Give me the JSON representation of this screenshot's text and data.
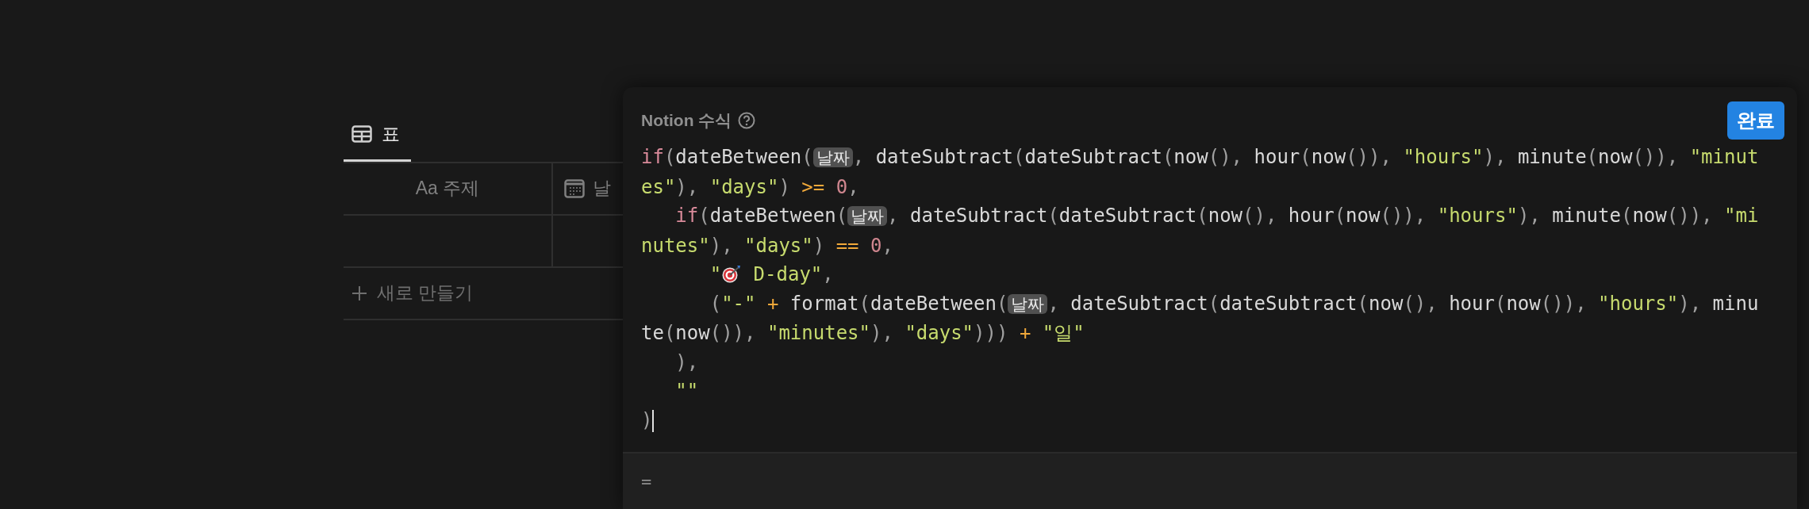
{
  "view_tabs": [
    {
      "label": "표",
      "selected": true
    }
  ],
  "table": {
    "columns": [
      {
        "label": "Aa 주제",
        "kind": "title"
      },
      {
        "label": "날",
        "kind": "date"
      }
    ],
    "new_row_label": "새로 만들기"
  },
  "formula_editor": {
    "title": "Notion 수식",
    "done_button": "완료",
    "lines": [
      {
        "segments": [
          {
            "kind": "code",
            "tokens": [
              {
                "kind": "keyword",
                "text": "if"
              },
              {
                "kind": "punct",
                "text": "("
              },
              {
                "kind": "ident",
                "text": "dateBetween"
              },
              {
                "kind": "punct",
                "text": "("
              }
            ]
          },
          {
            "kind": "prop",
            "text": "날짜"
          },
          {
            "kind": "code",
            "tokens": [
              {
                "kind": "punct",
                "text": ", "
              },
              {
                "kind": "ident",
                "text": "dateSubtract"
              },
              {
                "kind": "punct",
                "text": "("
              },
              {
                "kind": "ident",
                "text": "dateSubtract"
              },
              {
                "kind": "punct",
                "text": "("
              },
              {
                "kind": "ident",
                "text": "now"
              },
              {
                "kind": "punct",
                "text": "(), "
              },
              {
                "kind": "ident",
                "text": "hour"
              },
              {
                "kind": "punct",
                "text": "("
              },
              {
                "kind": "ident",
                "text": "now"
              },
              {
                "kind": "punct",
                "text": "()), "
              },
              {
                "kind": "string",
                "text": "\"hours\""
              },
              {
                "kind": "punct",
                "text": "), "
              },
              {
                "kind": "ident",
                "text": "minute"
              },
              {
                "kind": "punct",
                "text": "("
              },
              {
                "kind": "ident",
                "text": "now"
              },
              {
                "kind": "punct",
                "text": "()), "
              },
              {
                "kind": "string",
                "text": "\"minut"
              }
            ]
          }
        ]
      },
      {
        "segments": [
          {
            "kind": "code",
            "tokens": [
              {
                "kind": "string",
                "text": "es\""
              },
              {
                "kind": "punct",
                "text": "), "
              },
              {
                "kind": "string",
                "text": "\"days\""
              },
              {
                "kind": "punct",
                "text": ") "
              },
              {
                "kind": "op",
                "text": ">= "
              },
              {
                "kind": "number",
                "text": "0"
              },
              {
                "kind": "punct",
                "text": ","
              }
            ]
          }
        ]
      },
      {
        "segments": [
          {
            "kind": "code",
            "tokens": [
              {
                "kind": "keyword",
                "text": "   if"
              },
              {
                "kind": "punct",
                "text": "("
              },
              {
                "kind": "ident",
                "text": "dateBetween"
              },
              {
                "kind": "punct",
                "text": "("
              }
            ]
          },
          {
            "kind": "prop",
            "text": "날짜"
          },
          {
            "kind": "code",
            "tokens": [
              {
                "kind": "punct",
                "text": ", "
              },
              {
                "kind": "ident",
                "text": "dateSubtract"
              },
              {
                "kind": "punct",
                "text": "("
              },
              {
                "kind": "ident",
                "text": "dateSubtract"
              },
              {
                "kind": "punct",
                "text": "("
              },
              {
                "kind": "ident",
                "text": "now"
              },
              {
                "kind": "punct",
                "text": "(), "
              },
              {
                "kind": "ident",
                "text": "hour"
              },
              {
                "kind": "punct",
                "text": "("
              },
              {
                "kind": "ident",
                "text": "now"
              },
              {
                "kind": "punct",
                "text": "()), "
              },
              {
                "kind": "string",
                "text": "\"hours\""
              },
              {
                "kind": "punct",
                "text": "), "
              },
              {
                "kind": "ident",
                "text": "minute"
              },
              {
                "kind": "punct",
                "text": "("
              },
              {
                "kind": "ident",
                "text": "now"
              },
              {
                "kind": "punct",
                "text": "()), "
              },
              {
                "kind": "string",
                "text": "\"mi"
              }
            ]
          }
        ]
      },
      {
        "segments": [
          {
            "kind": "code",
            "tokens": [
              {
                "kind": "string",
                "text": "nutes\""
              },
              {
                "kind": "punct",
                "text": "), "
              },
              {
                "kind": "string",
                "text": "\"days\""
              },
              {
                "kind": "punct",
                "text": ") "
              },
              {
                "kind": "op",
                "text": "== "
              },
              {
                "kind": "number",
                "text": "0"
              },
              {
                "kind": "punct",
                "text": ","
              }
            ]
          }
        ]
      },
      {
        "segments": [
          {
            "kind": "code",
            "tokens": [
              {
                "kind": "string",
                "text": "      \""
              }
            ]
          },
          {
            "kind": "emoji"
          },
          {
            "kind": "code",
            "tokens": [
              {
                "kind": "string",
                "text": " D-day\""
              },
              {
                "kind": "punct",
                "text": ","
              }
            ]
          }
        ]
      },
      {
        "segments": [
          {
            "kind": "code",
            "tokens": [
              {
                "kind": "punct",
                "text": "      ("
              },
              {
                "kind": "string",
                "text": "\"-\" "
              },
              {
                "kind": "op",
                "text": "+ "
              },
              {
                "kind": "ident",
                "text": "format"
              },
              {
                "kind": "punct",
                "text": "("
              },
              {
                "kind": "ident",
                "text": "dateBetween"
              },
              {
                "kind": "punct",
                "text": "("
              }
            ]
          },
          {
            "kind": "prop",
            "text": "날짜"
          },
          {
            "kind": "code",
            "tokens": [
              {
                "kind": "punct",
                "text": ", "
              },
              {
                "kind": "ident",
                "text": "dateSubtract"
              },
              {
                "kind": "punct",
                "text": "("
              },
              {
                "kind": "ident",
                "text": "dateSubtract"
              },
              {
                "kind": "punct",
                "text": "("
              },
              {
                "kind": "ident",
                "text": "now"
              },
              {
                "kind": "punct",
                "text": "(), "
              },
              {
                "kind": "ident",
                "text": "hour"
              },
              {
                "kind": "punct",
                "text": "("
              },
              {
                "kind": "ident",
                "text": "now"
              },
              {
                "kind": "punct",
                "text": "()), "
              },
              {
                "kind": "string",
                "text": "\"hours\""
              },
              {
                "kind": "punct",
                "text": "), "
              },
              {
                "kind": "ident",
                "text": "minu"
              }
            ]
          }
        ]
      },
      {
        "segments": [
          {
            "kind": "code",
            "tokens": [
              {
                "kind": "ident",
                "text": "te"
              },
              {
                "kind": "punct",
                "text": "("
              },
              {
                "kind": "ident",
                "text": "now"
              },
              {
                "kind": "punct",
                "text": "()), "
              },
              {
                "kind": "string",
                "text": "\"minutes\""
              },
              {
                "kind": "punct",
                "text": "), "
              },
              {
                "kind": "string",
                "text": "\"days\""
              },
              {
                "kind": "punct",
                "text": "))) "
              },
              {
                "kind": "op",
                "text": "+ "
              },
              {
                "kind": "string",
                "text": "\"일\""
              }
            ]
          }
        ]
      },
      {
        "segments": [
          {
            "kind": "code",
            "tokens": [
              {
                "kind": "punct",
                "text": "   ),"
              }
            ]
          }
        ]
      },
      {
        "segments": [
          {
            "kind": "code",
            "tokens": [
              {
                "kind": "string",
                "text": "   \"\""
              }
            ]
          }
        ]
      },
      {
        "segments": [
          {
            "kind": "code",
            "tokens": [
              {
                "kind": "punct",
                "text": ")"
              }
            ]
          },
          {
            "kind": "cursor"
          }
        ]
      }
    ],
    "result": "="
  }
}
